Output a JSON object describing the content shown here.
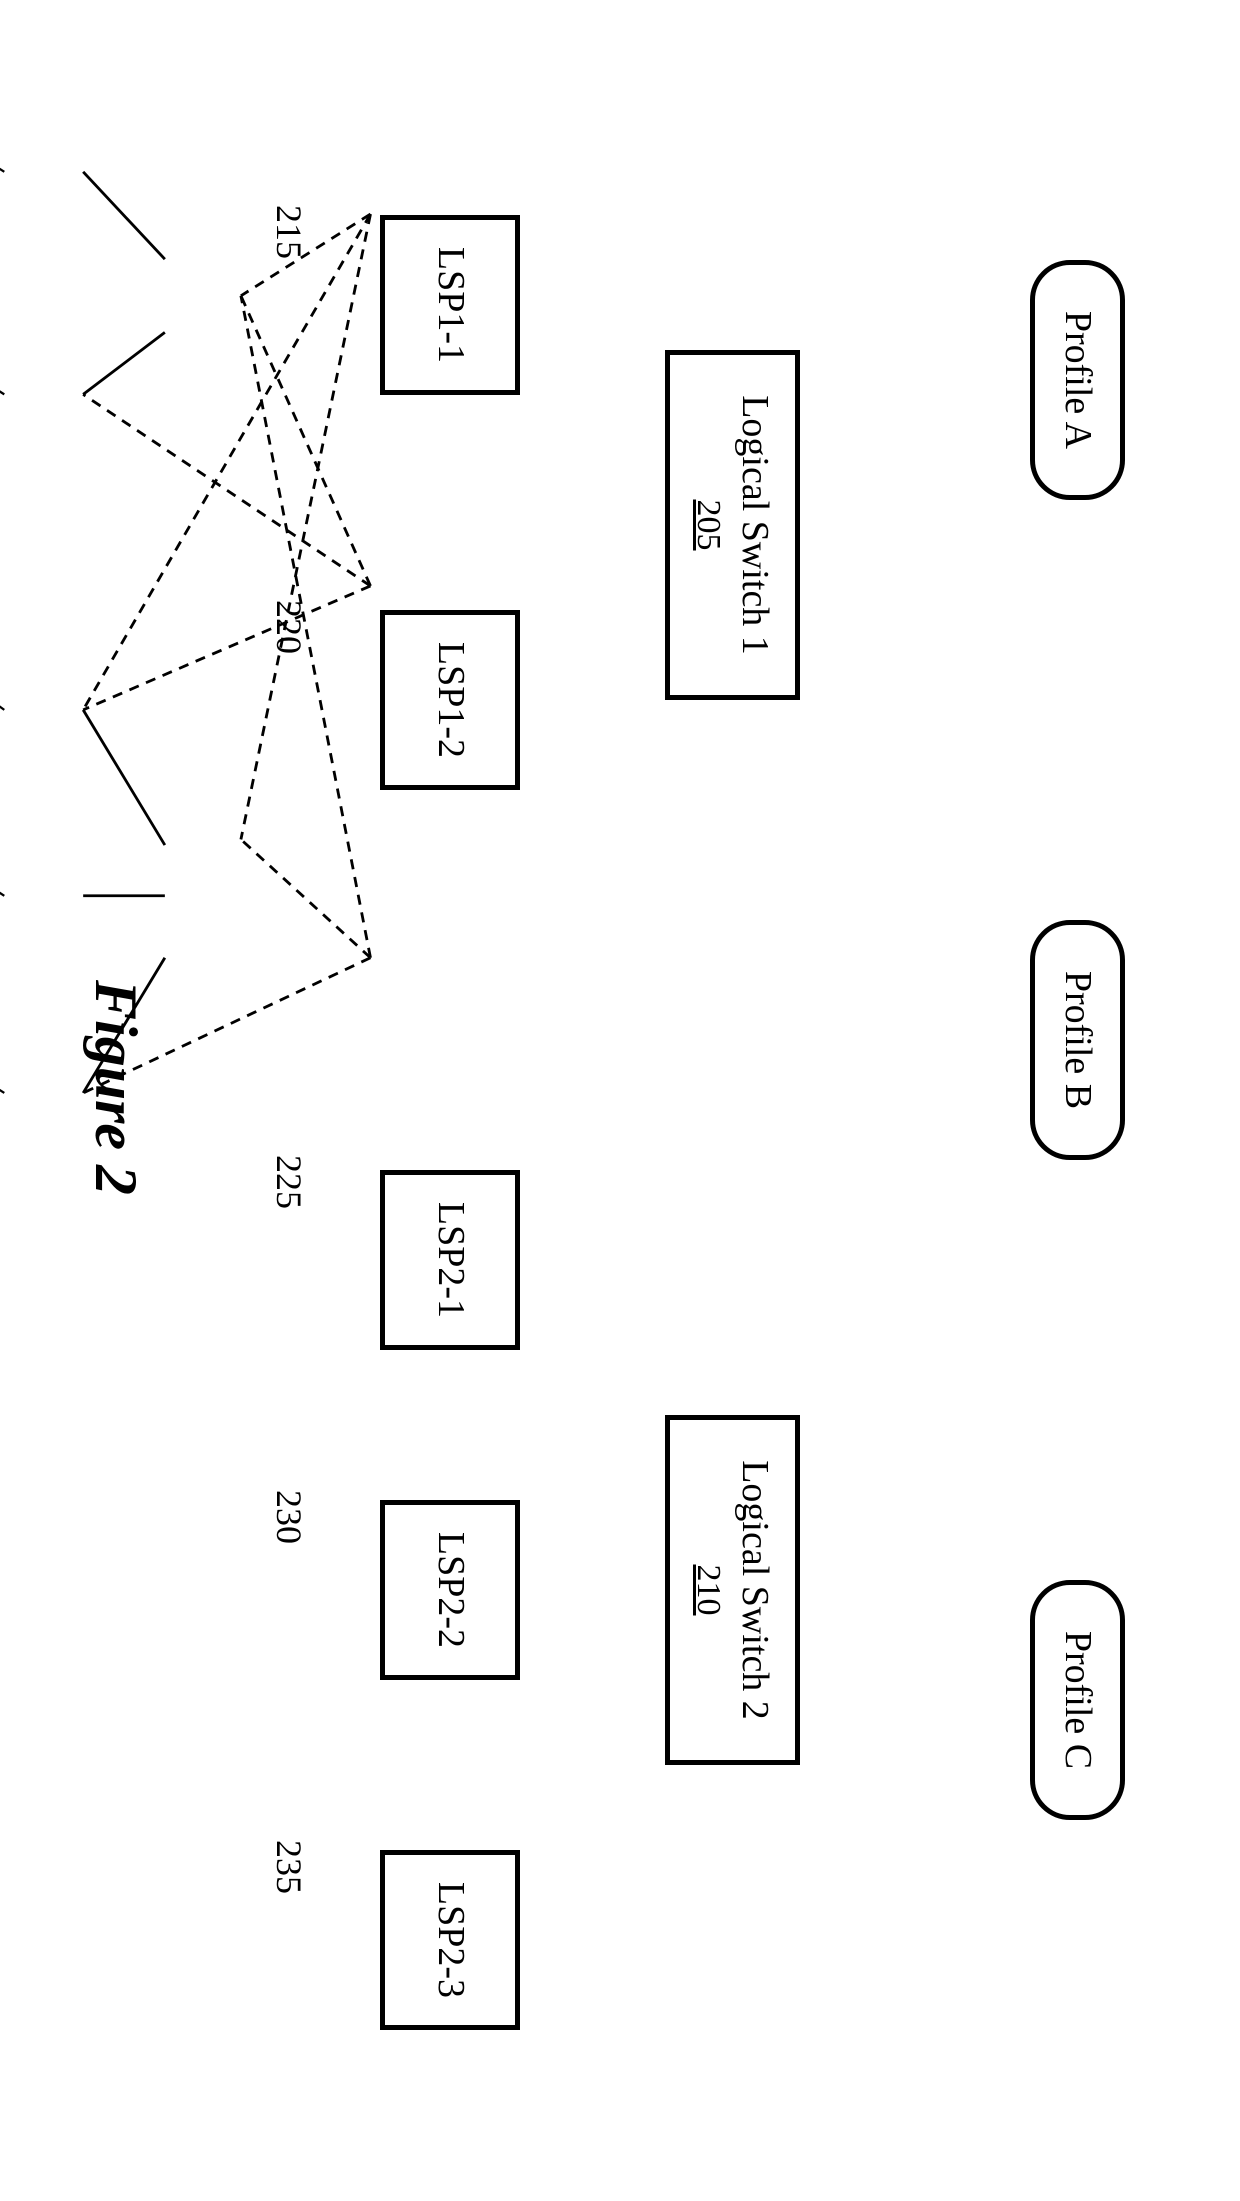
{
  "profiles": {
    "a": "Profile A",
    "b": "Profile B",
    "c": "Profile C"
  },
  "switches": {
    "s1": {
      "label": "Logical Switch 1",
      "ref": "205"
    },
    "s2": {
      "label": "Logical Switch 2",
      "ref": "210"
    }
  },
  "lsps": {
    "p11": {
      "label": "LSP1-1",
      "ref": "215"
    },
    "p12": {
      "label": "LSP1-2",
      "ref": "220"
    },
    "p21": {
      "label": "LSP2-1",
      "ref": "225"
    },
    "p22": {
      "label": "LSP2-2",
      "ref": "230"
    },
    "p23": {
      "label": "LSP2-3",
      "ref": "235"
    }
  },
  "caption": "Figure 2"
}
